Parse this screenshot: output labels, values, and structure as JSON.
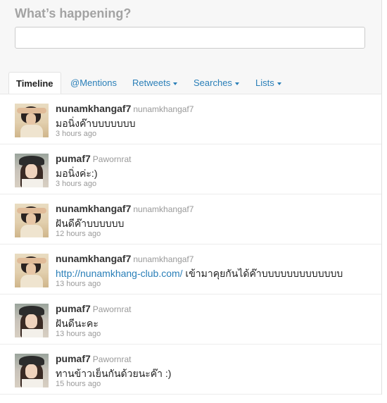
{
  "compose": {
    "prompt": "What’s happening?",
    "input_value": ""
  },
  "tabs": [
    {
      "label": "Timeline",
      "active": true,
      "dropdown": false
    },
    {
      "label": "@Mentions",
      "active": false,
      "dropdown": false
    },
    {
      "label": "Retweets",
      "active": false,
      "dropdown": true
    },
    {
      "label": "Searches",
      "active": false,
      "dropdown": true
    },
    {
      "label": "Lists",
      "active": false,
      "dropdown": true
    }
  ],
  "tweets": [
    {
      "name": "nunamkhangaf7",
      "handle": "nunamkhangaf7",
      "link": "",
      "text": "มอนิ่งค๊าบบบบบบบ",
      "time": "3 hours ago",
      "avatar": "avatar-nunamkhangaf7"
    },
    {
      "name": "pumaf7",
      "handle": "Pawornrat",
      "link": "",
      "text": "มอนิ่งค่ะ:)",
      "time": "3 hours ago",
      "avatar": "avatar-pumaf7"
    },
    {
      "name": "nunamkhangaf7",
      "handle": "nunamkhangaf7",
      "link": "",
      "text": "ฝันดีค๊าบบบบบบ",
      "time": "12 hours ago",
      "avatar": "avatar-nunamkhangaf7"
    },
    {
      "name": "nunamkhangaf7",
      "handle": "nunamkhangaf7",
      "link": "http://nunamkhang-club.com/",
      "text": " เข้ามาคุยกันได้ค๊าบบบบบบบบบบบบบ",
      "time": "13 hours ago",
      "avatar": "avatar-nunamkhangaf7"
    },
    {
      "name": "pumaf7",
      "handle": "Pawornrat",
      "link": "",
      "text": "ฝันดีนะคะ",
      "time": "13 hours ago",
      "avatar": "avatar-pumaf7"
    },
    {
      "name": "pumaf7",
      "handle": "Pawornrat",
      "link": "",
      "text": "ทานข้าวเย็นกันด้วยนะค๊า :)",
      "time": "15 hours ago",
      "avatar": "avatar-pumaf7"
    }
  ],
  "colors": {
    "link": "#2a7fb8",
    "muted": "#999999",
    "prompt": "#a3a3a3"
  }
}
